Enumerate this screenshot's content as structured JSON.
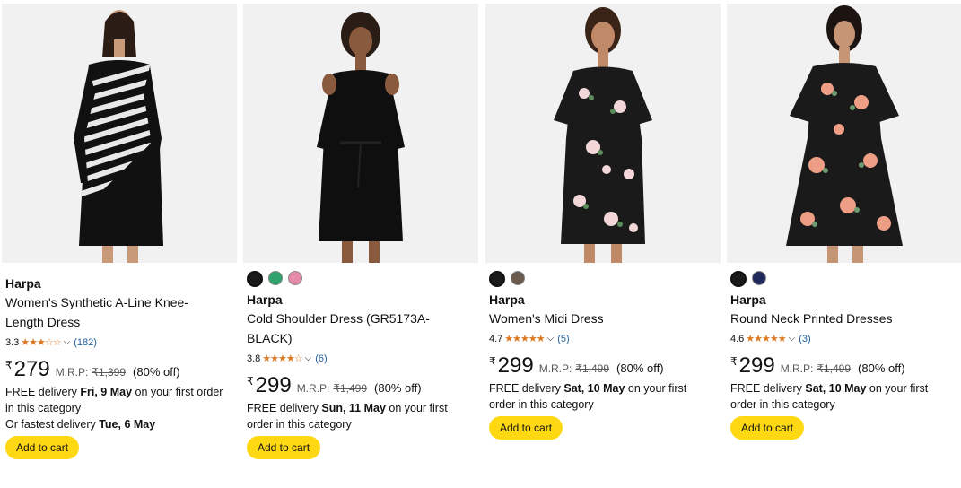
{
  "currency_symbol": "₹",
  "mrp_label": "M.R.P:",
  "products": [
    {
      "brand": "Harpa",
      "title_line1": "Women's Synthetic A-Line Knee-",
      "title_line2": "Length Dress",
      "rating": "3.3",
      "stars": "★★★☆☆",
      "rating_count": "(182)",
      "price": "279",
      "mrp": "₹1,399",
      "discount": "(80% off)",
      "delivery_prefix": "FREE delivery ",
      "delivery_date": "Fri, 9 May",
      "delivery_suffix": " on your first order",
      "delivery_line2": "in this category",
      "fastest_prefix": "Or fastest delivery ",
      "fastest_date": "Tue, 6 May",
      "cart_label": "Add to cart"
    },
    {
      "brand": "Harpa",
      "title_line1": "Cold Shoulder Dress (GR5173A-",
      "title_line2": "BLACK)",
      "rating": "3.8",
      "stars": "★★★★☆",
      "rating_count": "(6)",
      "price": "299",
      "mrp": "₹1,499",
      "discount": "(80% off)",
      "delivery_prefix": "FREE delivery ",
      "delivery_date": "Sun, 11 May",
      "delivery_suffix": " on your first",
      "delivery_line2": "order in this category",
      "cart_label": "Add to cart",
      "swatches": [
        "#1a1a1a",
        "#2fa36b",
        "#e58aa8"
      ]
    },
    {
      "brand": "Harpa",
      "title_line1": "Women's Midi Dress",
      "rating": "4.7",
      "stars": "★★★★★",
      "rating_count": "(5)",
      "price": "299",
      "mrp": "₹1,499",
      "discount": "(80% off)",
      "delivery_prefix": "FREE delivery ",
      "delivery_date": "Sat, 10 May",
      "delivery_suffix": " on your first",
      "delivery_line2": "order in this category",
      "cart_label": "Add to cart",
      "swatches": [
        "#1a1a1a",
        "#6b5a4e"
      ]
    },
    {
      "brand": "Harpa",
      "title_line1": "Round Neck Printed Dresses",
      "rating": "4.6",
      "stars": "★★★★★",
      "rating_count": "(3)",
      "price": "299",
      "mrp": "₹1,499",
      "discount": "(80% off)",
      "delivery_prefix": "FREE delivery ",
      "delivery_date": "Sat, 10 May",
      "delivery_suffix": " on your first",
      "delivery_line2": "order in this category",
      "cart_label": "Add to cart",
      "swatches": [
        "#1a1a1a",
        "#1f2a5a"
      ]
    }
  ],
  "colors": {
    "accent_star": "#de7921",
    "link": "#2162a1",
    "cart_button": "#ffd814",
    "image_bg": "#f1f1f1"
  },
  "icons": [
    "star-rating-icon",
    "chevron-down-icon"
  ]
}
